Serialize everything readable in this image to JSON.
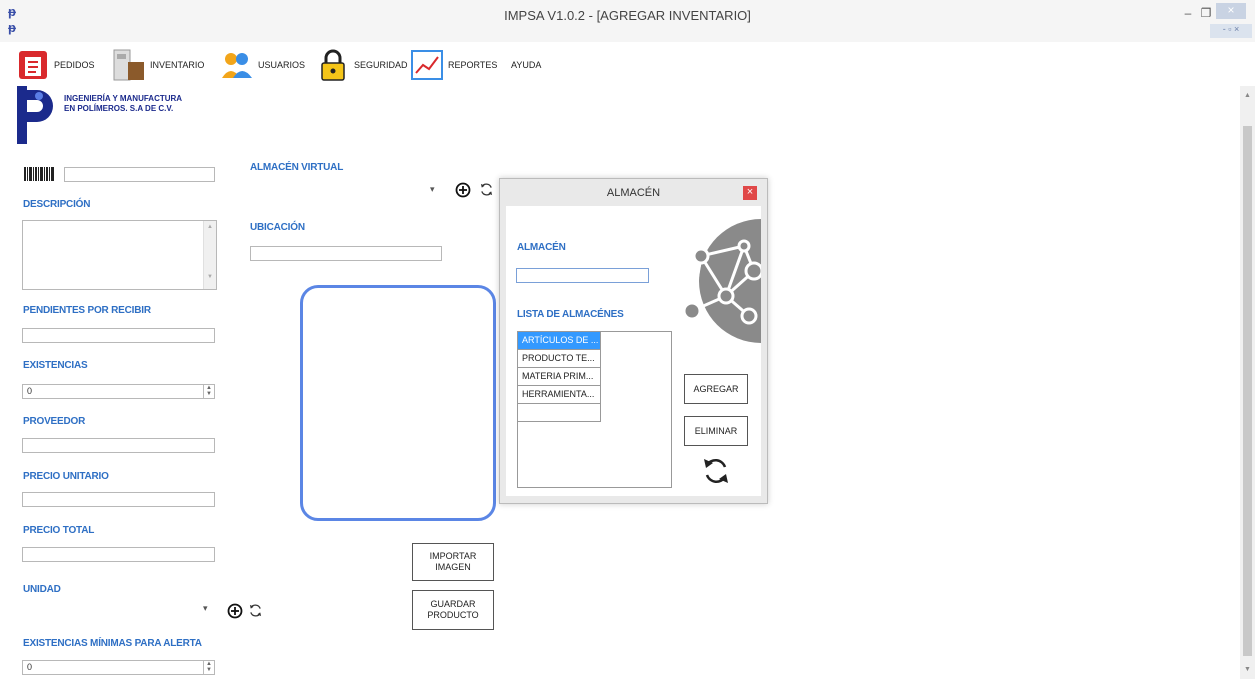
{
  "window": {
    "title": "IMPSA V1.0.2 - [AGREGAR INVENTARIO]",
    "app_icon": "impsa-logo-icon",
    "minimize": "–",
    "maximize": "❐",
    "close": "×",
    "mdi_controls": "- ▫ ×"
  },
  "menu": {
    "items": [
      {
        "label": "PEDIDOS",
        "icon": "orders-icon"
      },
      {
        "label": "INVENTARIO",
        "icon": "inventory-icon"
      },
      {
        "label": "USUARIOS",
        "icon": "users-icon"
      },
      {
        "label": "SEGURIDAD",
        "icon": "lock-icon"
      },
      {
        "label": "REPORTES",
        "icon": "chart-icon"
      },
      {
        "label": "AYUDA",
        "icon": ""
      }
    ]
  },
  "company": {
    "name_line1": "INGENIERÍA Y MANUFACTURA",
    "name_line2": "EN POLÍMEROS. S.A DE C.V."
  },
  "form": {
    "barcode_value": "",
    "descripcion_label": "DESCRIPCIÓN",
    "pendientes_label": "PENDIENTES POR RECIBIR",
    "existencias_label": "EXISTENCIAS",
    "existencias_value": "0",
    "proveedor_label": "PROVEEDOR",
    "precio_unitario_label": "PRECIO UNITARIO",
    "precio_total_label": "PRECIO TOTAL",
    "unidad_label": "UNIDAD",
    "existencias_min_label": "EXISTENCIAS MÍNIMAS PARA ALERTA",
    "existencias_min_value": "0",
    "almacen_virtual_label": "ALMACÉN VIRTUAL",
    "ubicacion_label": "UBICACIÓN",
    "importar_label_1": "IMPORTAR",
    "importar_label_2": "IMAGEN",
    "guardar_label_1": "GUARDAR",
    "guardar_label_2": "PRODUCTO"
  },
  "dialog": {
    "title": "ALMACÉN",
    "close": "×",
    "almacen_label": "ALMACÉN",
    "almacen_value": "",
    "lista_label": "LISTA DE ALMACÉNES",
    "items": [
      "ARTÍCULOS DE ...",
      "PRODUCTO TE...",
      "MATERIA PRIM...",
      "HERRAMIENTA...",
      ""
    ],
    "agregar": "AGREGAR",
    "eliminar": "ELIMINAR"
  },
  "colors": {
    "label_blue": "#2e6fc4",
    "selection_blue": "#3399ff",
    "image_frame": "#5b86e5",
    "dialog_close": "#e04848",
    "network_gray": "#8a8a8a"
  }
}
